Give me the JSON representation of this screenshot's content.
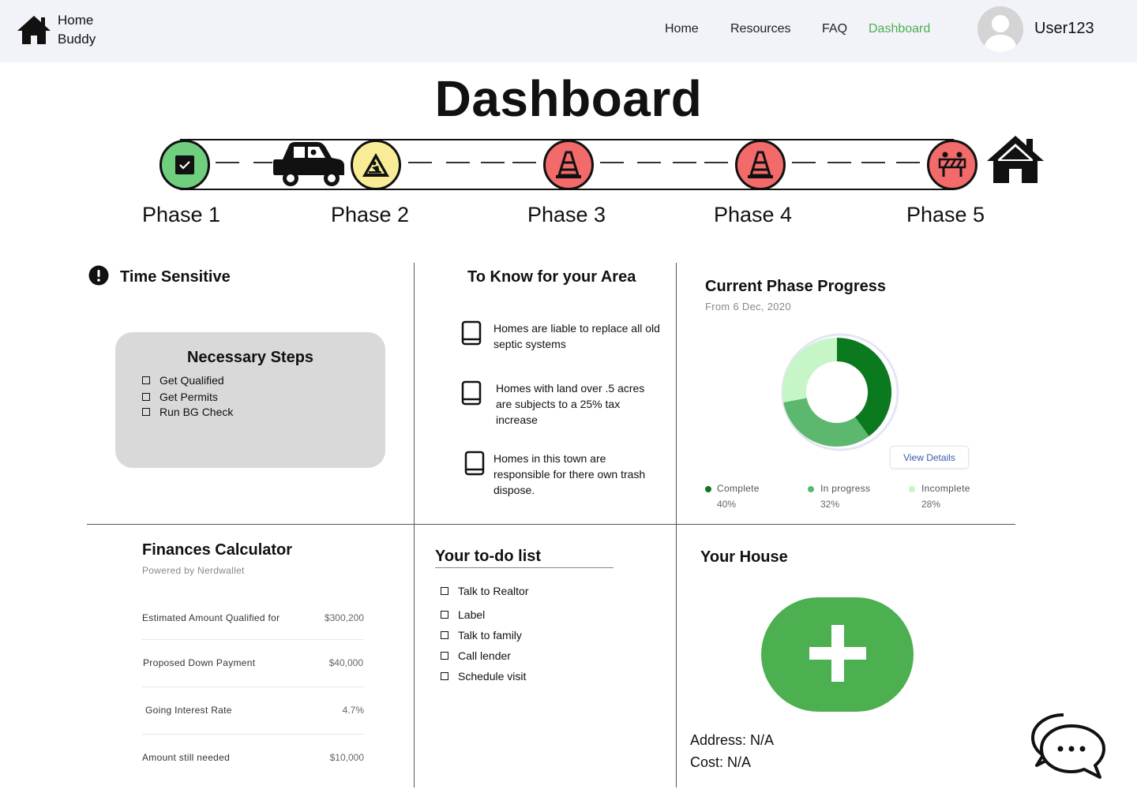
{
  "header": {
    "brand_line1": "Home",
    "brand_line2": "Buddy",
    "nav": [
      "Home",
      "Resources",
      "FAQ",
      "Dashboard"
    ],
    "active_nav": "Dashboard",
    "username": "User123"
  },
  "page_title": "Dashboard",
  "phases": {
    "labels": [
      "Phase 1",
      "Phase 2",
      "Phase 3",
      "Phase 4",
      "Phase 5"
    ],
    "status_colors": [
      "#6fcf7f",
      "#f8ed96",
      "#f26a6a",
      "#f26a6a",
      "#f26a6a"
    ],
    "icons": [
      "check-icon",
      "worker-icon",
      "cone-icon",
      "cone-icon",
      "barrier-icon"
    ],
    "current_marker": "car-icon",
    "goal_marker": "house-icon"
  },
  "time_sensitive": {
    "title": "Time Sensitive",
    "card_title": "Necessary Steps",
    "steps": [
      "Get Qualified",
      "Get Permits",
      "Run BG Check"
    ]
  },
  "area": {
    "title": "To Know for your Area",
    "items": [
      "Homes are liable to replace all old septic systems",
      "Homes with land over .5 acres are subjects to a 25% tax increase",
      "Homes in this town are responsible for there own trash dispose."
    ]
  },
  "progress": {
    "title": "Current Phase Progress",
    "subtitle": "From 6 Dec, 2020",
    "view_details": "View Details",
    "colors": {
      "complete": "#0b7a1f",
      "in_progress": "#5cb86e",
      "incomplete": "#c6f5c8"
    },
    "legend": [
      {
        "name": "Complete",
        "pct": "40%"
      },
      {
        "name": "In progress",
        "pct": "32%"
      },
      {
        "name": "Incomplete",
        "pct": "28%"
      }
    ]
  },
  "chart_data": {
    "type": "pie",
    "categories": [
      "Complete",
      "In progress",
      "Incomplete"
    ],
    "values": [
      40,
      32,
      28
    ]
  },
  "finances": {
    "title": "Finances Calculator",
    "powered_by": "Powered by Nerdwallet",
    "rows": [
      {
        "label": "Estimated Amount Qualified for",
        "value": "$300,200"
      },
      {
        "label": "Proposed Down Payment",
        "value": "$40,000"
      },
      {
        "label": "Going Interest Rate",
        "value": "4.7%"
      },
      {
        "label": "Amount still needed",
        "value": "$10,000"
      }
    ]
  },
  "todo": {
    "title": "Your to-do list",
    "items": [
      "Talk to Realtor",
      "Label",
      "Talk to family",
      "Call lender",
      "Schedule visit"
    ]
  },
  "house": {
    "title": "Your House",
    "address": "Address: N/A",
    "cost": "Cost: N/A"
  }
}
